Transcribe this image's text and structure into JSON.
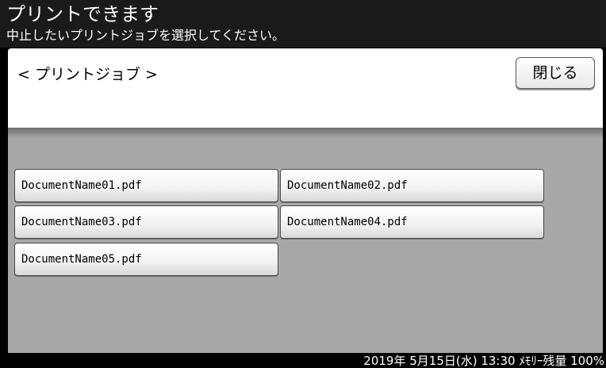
{
  "header": {
    "title": "プリントできます",
    "subtitle": "中止したいプリントジョブを選択してください。"
  },
  "panel": {
    "label": "< プリントジョブ >",
    "close_label": "閉じる"
  },
  "jobs": [
    {
      "name": "DocumentName01.pdf"
    },
    {
      "name": "DocumentName02.pdf"
    },
    {
      "name": "DocumentName03.pdf"
    },
    {
      "name": "DocumentName04.pdf"
    },
    {
      "name": "DocumentName05.pdf"
    }
  ],
  "status": {
    "text": "2019年 5月15日(水) 13:30 ﾒﾓﾘｰ残量 100%"
  }
}
